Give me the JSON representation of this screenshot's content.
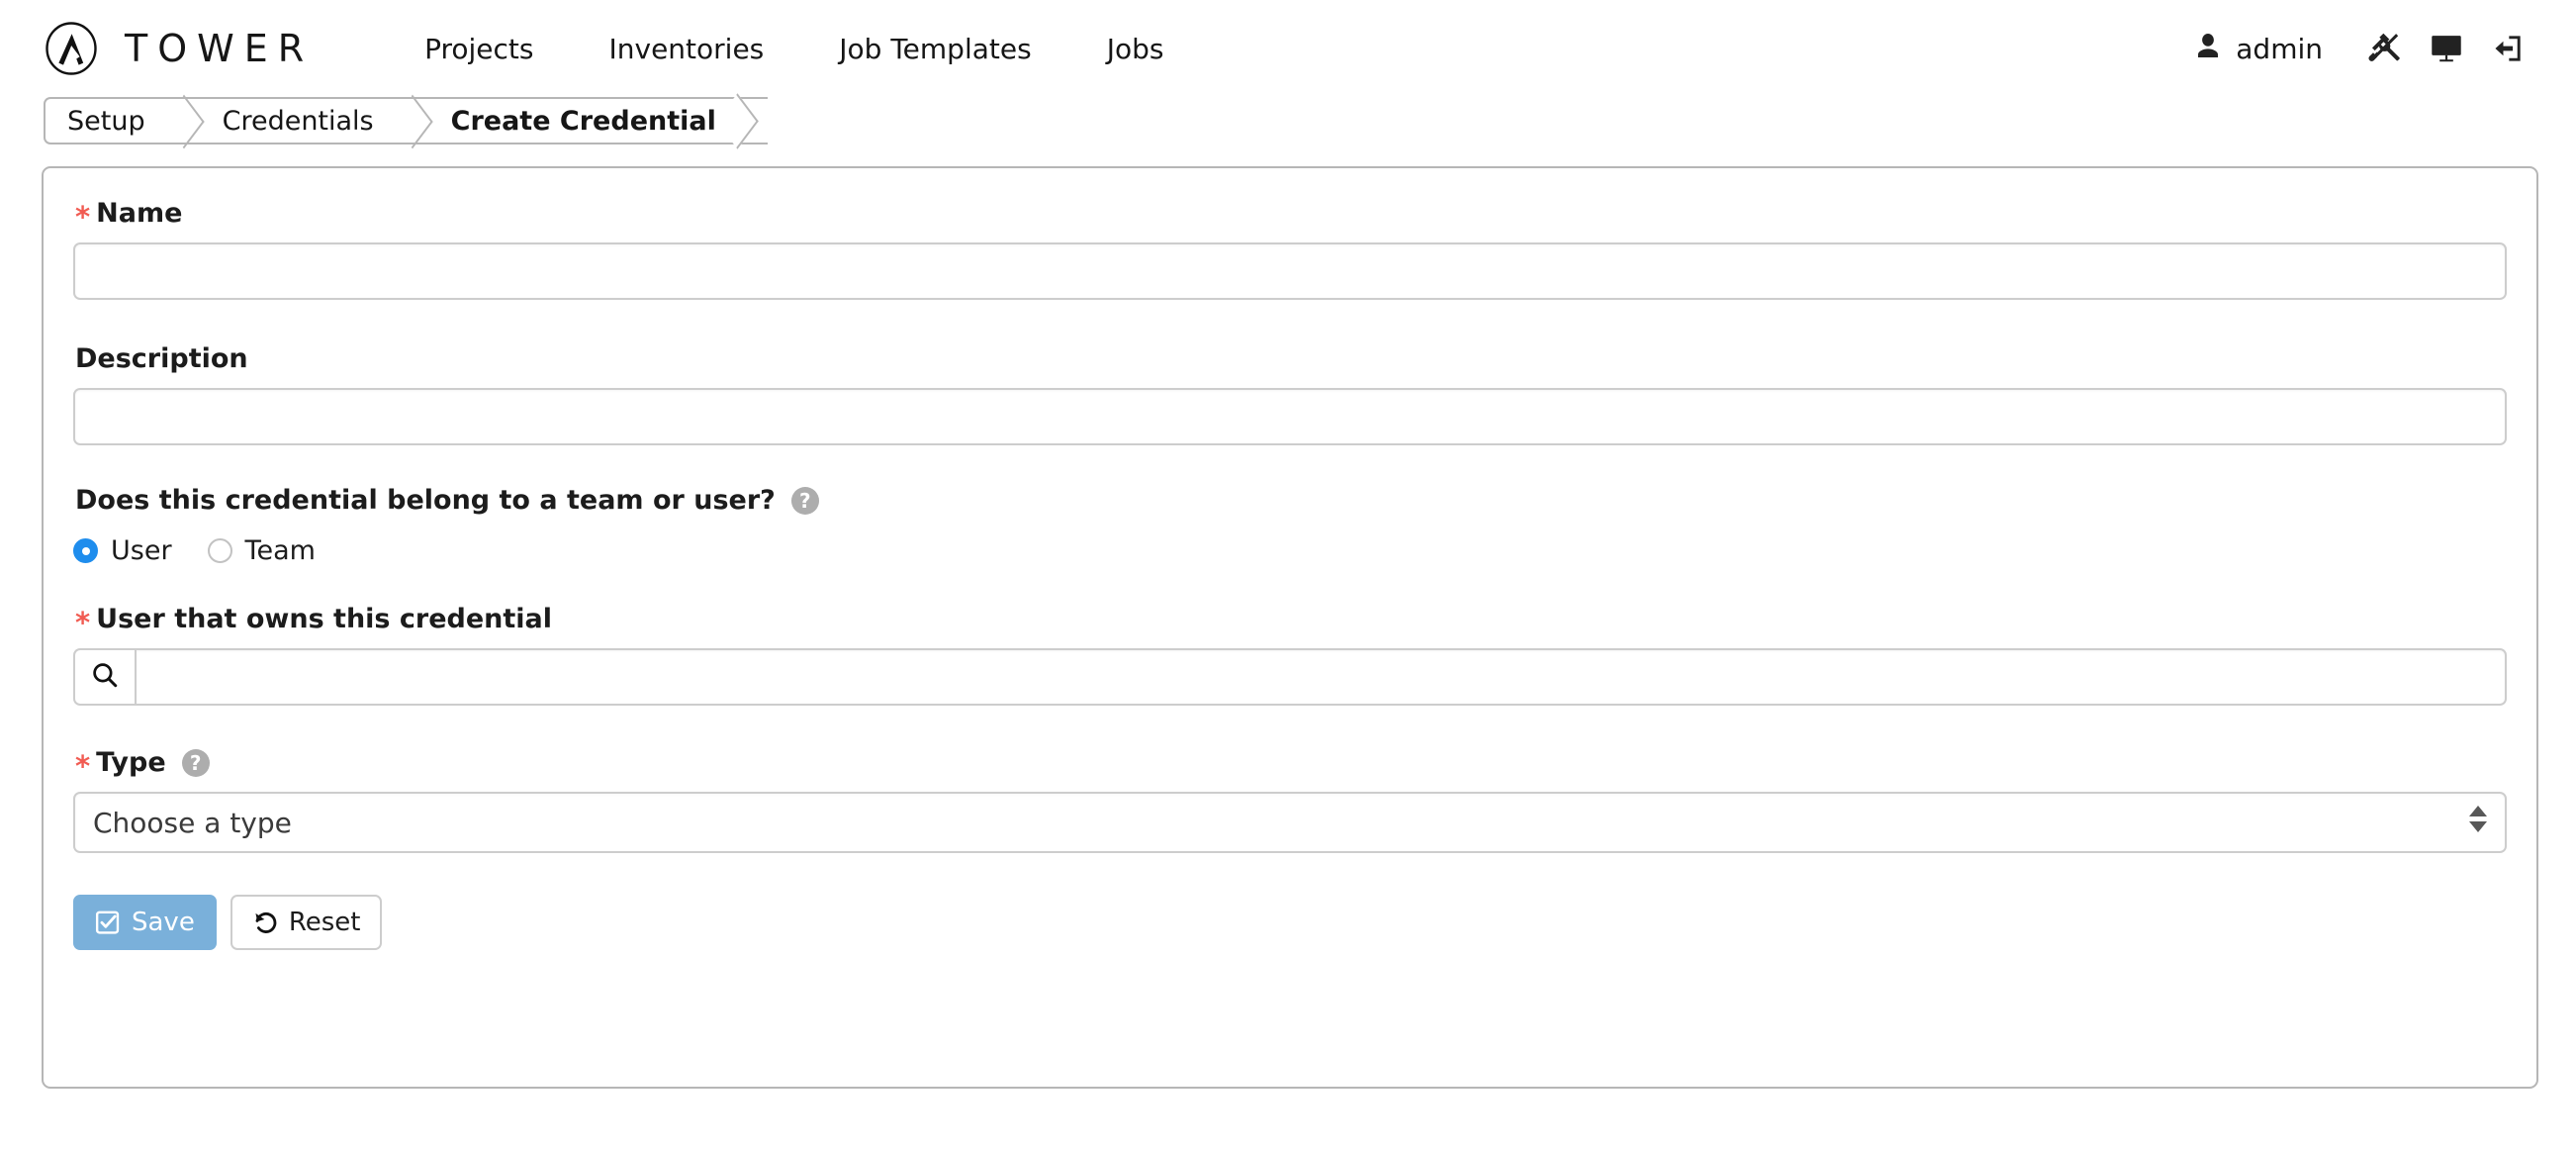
{
  "brand": {
    "logo_icon": "ansible-logo-icon",
    "name": "TOWER"
  },
  "nav": {
    "links": [
      {
        "label": "Projects"
      },
      {
        "label": "Inventories"
      },
      {
        "label": "Job Templates"
      },
      {
        "label": "Jobs"
      }
    ],
    "user": {
      "icon": "user-icon",
      "name": "admin"
    },
    "actions": [
      {
        "icon": "tools-icon",
        "name": "settings"
      },
      {
        "icon": "monitor-icon",
        "name": "view-dashboard"
      },
      {
        "icon": "sign-out-icon",
        "name": "logout"
      }
    ]
  },
  "breadcrumb": {
    "items": [
      {
        "label": "Setup",
        "active": false
      },
      {
        "label": "Credentials",
        "active": false
      },
      {
        "label": "Create Credential",
        "active": true
      }
    ]
  },
  "form": {
    "name": {
      "label": "Name",
      "required_marker": "*",
      "value": "",
      "placeholder": ""
    },
    "description": {
      "label": "Description",
      "value": "",
      "placeholder": ""
    },
    "ownership": {
      "label": "Does this credential belong to a team or user?",
      "help_icon": "question-mark-icon",
      "options": [
        {
          "label": "User",
          "selected": true
        },
        {
          "label": "Team",
          "selected": false
        }
      ]
    },
    "owner": {
      "label": "User that owns this credential",
      "required_marker": "*",
      "search_icon": "search-icon",
      "value": "",
      "placeholder": ""
    },
    "type": {
      "label": "Type",
      "required_marker": "*",
      "help_icon": "question-mark-icon",
      "selected": "Choose a type",
      "options": [
        "Choose a type"
      ],
      "dropdown_icon": "updown-arrows-icon"
    },
    "buttons": {
      "save": {
        "label": "Save",
        "icon": "check-square-icon"
      },
      "reset": {
        "label": "Reset",
        "icon": "undo-icon"
      }
    }
  },
  "colors": {
    "required": "#f15c53",
    "radio_selected": "#1f8ded",
    "save_button": "#7ab0da",
    "border": "#cdcdcd",
    "help_icon": "#adadad"
  }
}
